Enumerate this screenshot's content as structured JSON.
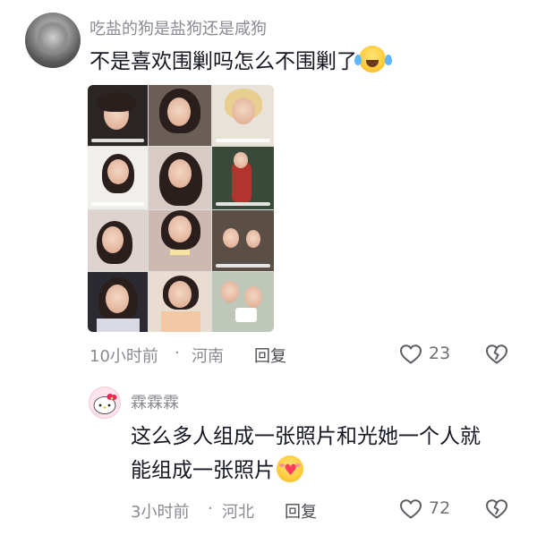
{
  "comments": [
    {
      "username": "吃盐的狗是盐狗还是咸狗",
      "text": "不是喜欢围剿吗怎么不围剿了",
      "time": "10小时前",
      "sep": "·",
      "location": "河南",
      "reply": "回复",
      "likes": "23"
    },
    {
      "username": "霖霖霖",
      "text_line1": "这么多人组成一张照片和光她一个人就",
      "text_line2": "能组成一张照片",
      "time": "3小时前",
      "sep": "·",
      "location": "河北",
      "reply": "回复",
      "likes": "72"
    }
  ],
  "icons": {
    "like": "heart-outline-icon",
    "dislike": "broken-heart-icon",
    "emoji1": "face-with-tears-of-joy-emoji",
    "emoji2": "smiling-face-holding-heart-emoji"
  },
  "colors": {
    "text": "#161823",
    "meta": "#8a8b91",
    "icon": "#5c5d63"
  }
}
